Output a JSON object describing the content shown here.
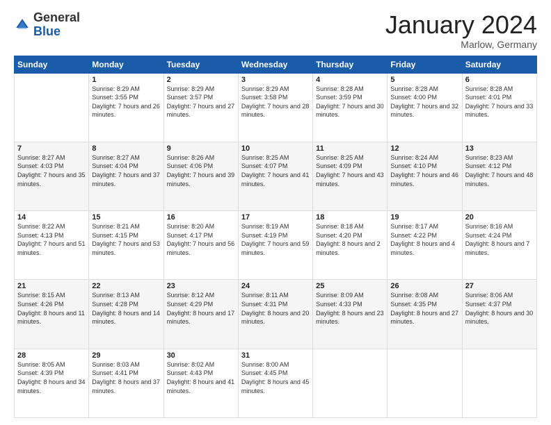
{
  "header": {
    "logo_general": "General",
    "logo_blue": "Blue",
    "month_title": "January 2024",
    "location": "Marlow, Germany"
  },
  "weekdays": [
    "Sunday",
    "Monday",
    "Tuesday",
    "Wednesday",
    "Thursday",
    "Friday",
    "Saturday"
  ],
  "weeks": [
    [
      {
        "day": "",
        "sunrise": "",
        "sunset": "",
        "daylight": ""
      },
      {
        "day": "1",
        "sunrise": "Sunrise: 8:29 AM",
        "sunset": "Sunset: 3:55 PM",
        "daylight": "Daylight: 7 hours and 26 minutes."
      },
      {
        "day": "2",
        "sunrise": "Sunrise: 8:29 AM",
        "sunset": "Sunset: 3:57 PM",
        "daylight": "Daylight: 7 hours and 27 minutes."
      },
      {
        "day": "3",
        "sunrise": "Sunrise: 8:29 AM",
        "sunset": "Sunset: 3:58 PM",
        "daylight": "Daylight: 7 hours and 28 minutes."
      },
      {
        "day": "4",
        "sunrise": "Sunrise: 8:28 AM",
        "sunset": "Sunset: 3:59 PM",
        "daylight": "Daylight: 7 hours and 30 minutes."
      },
      {
        "day": "5",
        "sunrise": "Sunrise: 8:28 AM",
        "sunset": "Sunset: 4:00 PM",
        "daylight": "Daylight: 7 hours and 32 minutes."
      },
      {
        "day": "6",
        "sunrise": "Sunrise: 8:28 AM",
        "sunset": "Sunset: 4:01 PM",
        "daylight": "Daylight: 7 hours and 33 minutes."
      }
    ],
    [
      {
        "day": "7",
        "sunrise": "Sunrise: 8:27 AM",
        "sunset": "Sunset: 4:03 PM",
        "daylight": "Daylight: 7 hours and 35 minutes."
      },
      {
        "day": "8",
        "sunrise": "Sunrise: 8:27 AM",
        "sunset": "Sunset: 4:04 PM",
        "daylight": "Daylight: 7 hours and 37 minutes."
      },
      {
        "day": "9",
        "sunrise": "Sunrise: 8:26 AM",
        "sunset": "Sunset: 4:06 PM",
        "daylight": "Daylight: 7 hours and 39 minutes."
      },
      {
        "day": "10",
        "sunrise": "Sunrise: 8:25 AM",
        "sunset": "Sunset: 4:07 PM",
        "daylight": "Daylight: 7 hours and 41 minutes."
      },
      {
        "day": "11",
        "sunrise": "Sunrise: 8:25 AM",
        "sunset": "Sunset: 4:09 PM",
        "daylight": "Daylight: 7 hours and 43 minutes."
      },
      {
        "day": "12",
        "sunrise": "Sunrise: 8:24 AM",
        "sunset": "Sunset: 4:10 PM",
        "daylight": "Daylight: 7 hours and 46 minutes."
      },
      {
        "day": "13",
        "sunrise": "Sunrise: 8:23 AM",
        "sunset": "Sunset: 4:12 PM",
        "daylight": "Daylight: 7 hours and 48 minutes."
      }
    ],
    [
      {
        "day": "14",
        "sunrise": "Sunrise: 8:22 AM",
        "sunset": "Sunset: 4:13 PM",
        "daylight": "Daylight: 7 hours and 51 minutes."
      },
      {
        "day": "15",
        "sunrise": "Sunrise: 8:21 AM",
        "sunset": "Sunset: 4:15 PM",
        "daylight": "Daylight: 7 hours and 53 minutes."
      },
      {
        "day": "16",
        "sunrise": "Sunrise: 8:20 AM",
        "sunset": "Sunset: 4:17 PM",
        "daylight": "Daylight: 7 hours and 56 minutes."
      },
      {
        "day": "17",
        "sunrise": "Sunrise: 8:19 AM",
        "sunset": "Sunset: 4:19 PM",
        "daylight": "Daylight: 7 hours and 59 minutes."
      },
      {
        "day": "18",
        "sunrise": "Sunrise: 8:18 AM",
        "sunset": "Sunset: 4:20 PM",
        "daylight": "Daylight: 8 hours and 2 minutes."
      },
      {
        "day": "19",
        "sunrise": "Sunrise: 8:17 AM",
        "sunset": "Sunset: 4:22 PM",
        "daylight": "Daylight: 8 hours and 4 minutes."
      },
      {
        "day": "20",
        "sunrise": "Sunrise: 8:16 AM",
        "sunset": "Sunset: 4:24 PM",
        "daylight": "Daylight: 8 hours and 7 minutes."
      }
    ],
    [
      {
        "day": "21",
        "sunrise": "Sunrise: 8:15 AM",
        "sunset": "Sunset: 4:26 PM",
        "daylight": "Daylight: 8 hours and 11 minutes."
      },
      {
        "day": "22",
        "sunrise": "Sunrise: 8:13 AM",
        "sunset": "Sunset: 4:28 PM",
        "daylight": "Daylight: 8 hours and 14 minutes."
      },
      {
        "day": "23",
        "sunrise": "Sunrise: 8:12 AM",
        "sunset": "Sunset: 4:29 PM",
        "daylight": "Daylight: 8 hours and 17 minutes."
      },
      {
        "day": "24",
        "sunrise": "Sunrise: 8:11 AM",
        "sunset": "Sunset: 4:31 PM",
        "daylight": "Daylight: 8 hours and 20 minutes."
      },
      {
        "day": "25",
        "sunrise": "Sunrise: 8:09 AM",
        "sunset": "Sunset: 4:33 PM",
        "daylight": "Daylight: 8 hours and 23 minutes."
      },
      {
        "day": "26",
        "sunrise": "Sunrise: 8:08 AM",
        "sunset": "Sunset: 4:35 PM",
        "daylight": "Daylight: 8 hours and 27 minutes."
      },
      {
        "day": "27",
        "sunrise": "Sunrise: 8:06 AM",
        "sunset": "Sunset: 4:37 PM",
        "daylight": "Daylight: 8 hours and 30 minutes."
      }
    ],
    [
      {
        "day": "28",
        "sunrise": "Sunrise: 8:05 AM",
        "sunset": "Sunset: 4:39 PM",
        "daylight": "Daylight: 8 hours and 34 minutes."
      },
      {
        "day": "29",
        "sunrise": "Sunrise: 8:03 AM",
        "sunset": "Sunset: 4:41 PM",
        "daylight": "Daylight: 8 hours and 37 minutes."
      },
      {
        "day": "30",
        "sunrise": "Sunrise: 8:02 AM",
        "sunset": "Sunset: 4:43 PM",
        "daylight": "Daylight: 8 hours and 41 minutes."
      },
      {
        "day": "31",
        "sunrise": "Sunrise: 8:00 AM",
        "sunset": "Sunset: 4:45 PM",
        "daylight": "Daylight: 8 hours and 45 minutes."
      },
      {
        "day": "",
        "sunrise": "",
        "sunset": "",
        "daylight": ""
      },
      {
        "day": "",
        "sunrise": "",
        "sunset": "",
        "daylight": ""
      },
      {
        "day": "",
        "sunrise": "",
        "sunset": "",
        "daylight": ""
      }
    ]
  ]
}
